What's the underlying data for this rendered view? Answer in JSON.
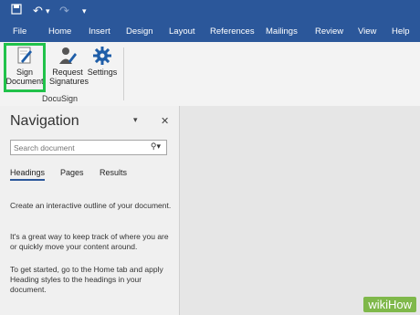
{
  "quick_access": {
    "save_icon": "save-icon",
    "undo_icon": "undo-icon",
    "redo_icon": "redo-icon",
    "customize_icon": "customize-icon"
  },
  "tabs": [
    "File",
    "Home",
    "Insert",
    "Design",
    "Layout",
    "References",
    "Mailings",
    "Review",
    "View",
    "Help"
  ],
  "ribbon": {
    "sign_document": "Sign\nDocument",
    "request_signatures": "Request\nSignatures",
    "settings": "Settings",
    "group_label": "DocuSign"
  },
  "navigation": {
    "title": "Navigation",
    "search_placeholder": "Search document",
    "tabs": [
      "Headings",
      "Pages",
      "Results"
    ],
    "paragraphs": [
      "Create an interactive outline of your document.",
      "It's a great way to keep track of where you are or quickly move your content around.",
      "To get started, go to the Home tab and apply Heading styles to the headings in your document."
    ]
  },
  "watermark": "wikiHow",
  "colors": {
    "titlebar": "#2b579a",
    "highlight": "#21c24a"
  }
}
